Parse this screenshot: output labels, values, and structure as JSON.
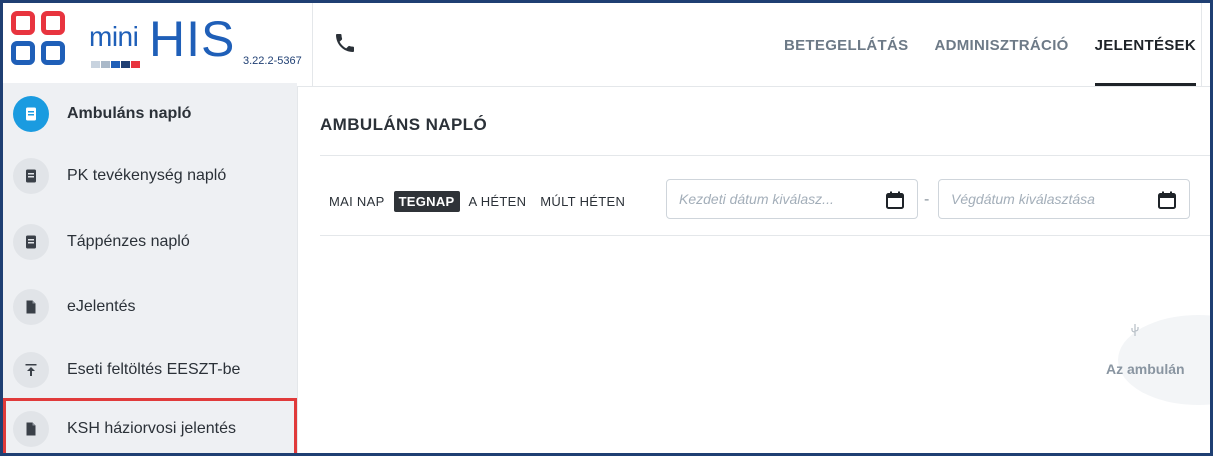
{
  "app": {
    "brand_mini": "mini",
    "brand_his": "HIS",
    "version": "3.22.2-5367"
  },
  "topnav": [
    {
      "label": "BETEGELLÁTÁS",
      "active": false
    },
    {
      "label": "ADMINISZTRÁCIÓ",
      "active": false
    },
    {
      "label": "JELENTÉSEK",
      "active": true
    }
  ],
  "sidebar": {
    "items": [
      {
        "label": "Ambuláns napló",
        "icon": "notebook-icon",
        "active": true
      },
      {
        "label": "PK tevékenység napló",
        "icon": "notebook-icon",
        "active": false
      },
      {
        "label": "Táppénzes napló",
        "icon": "notebook-icon",
        "active": false
      },
      {
        "label": "eJelentés",
        "icon": "file-icon",
        "active": false
      },
      {
        "label": "Eseti feltöltés EESZT-be",
        "icon": "upload-icon",
        "active": false
      },
      {
        "label": "KSH háziorvosi jelentés",
        "icon": "file-icon",
        "active": false,
        "highlighted": true
      }
    ]
  },
  "main": {
    "title": "AMBULÁNS NAPLÓ",
    "filters": [
      {
        "label": "MAI NAP",
        "active": false
      },
      {
        "label": "TEGNAP",
        "active": true
      },
      {
        "label": "A HÉTEN",
        "active": false
      },
      {
        "label": "MÚLT HÉTEN",
        "active": false
      }
    ],
    "start_date_placeholder": "Kezdeti dátum kiválasz...",
    "end_date_placeholder": "Végdátum kiválasztása",
    "range_separator": "-",
    "empty_text": "Az ambulán"
  },
  "colors": {
    "accent": "#1a9be0",
    "brand": "#1f5fb8",
    "highlight": "#e03a3a",
    "frame": "#1f3f73"
  }
}
